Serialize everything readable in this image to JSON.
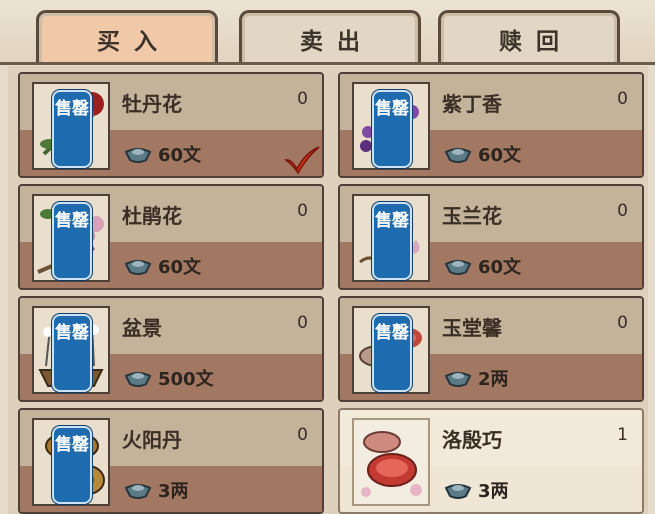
{
  "tabs": [
    {
      "label": "买入",
      "active": true
    },
    {
      "label": "卖出",
      "active": false
    },
    {
      "label": "赎回",
      "active": false
    }
  ],
  "seal_text": "售罄",
  "items": [
    {
      "name": "牡丹花",
      "count": "0",
      "price": "60文",
      "sold_out": true,
      "icon": "peony-icon"
    },
    {
      "name": "紫丁香",
      "count": "0",
      "price": "60文",
      "sold_out": true,
      "icon": "lilac-icon"
    },
    {
      "name": "杜鹃花",
      "count": "0",
      "price": "60文",
      "sold_out": true,
      "icon": "azalea-icon"
    },
    {
      "name": "玉兰花",
      "count": "0",
      "price": "60文",
      "sold_out": true,
      "icon": "magnolia-icon"
    },
    {
      "name": "盆景",
      "count": "0",
      "price": "500文",
      "sold_out": true,
      "icon": "bonsai-icon"
    },
    {
      "name": "玉堂馨",
      "count": "0",
      "price": "2两",
      "sold_out": true,
      "icon": "rouge-box-icon"
    },
    {
      "name": "火阳丹",
      "count": "0",
      "price": "3两",
      "sold_out": true,
      "icon": "incense-box-icon"
    },
    {
      "name": "洛殷巧",
      "count": "1",
      "price": "3两",
      "sold_out": false,
      "icon": "cosmetic-box-icon"
    }
  ],
  "colors": {
    "seal": "#1f6bb0",
    "check": "#d6341c",
    "active_tab": "#f0c9a8"
  }
}
